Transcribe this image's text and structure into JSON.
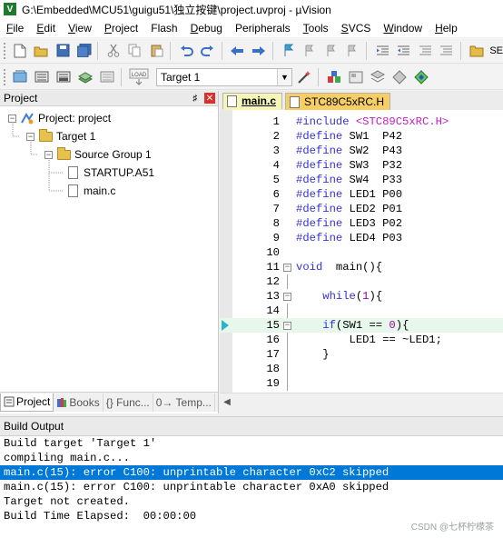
{
  "window": {
    "title": "G:\\Embedded\\MCU51\\guigu51\\独立按键\\project.uvproj - µVision"
  },
  "menu": [
    {
      "label": "File",
      "underline": "F",
      "rest": "ile"
    },
    {
      "label": "Edit",
      "underline": "E",
      "rest": "dit"
    },
    {
      "label": "View",
      "underline": "V",
      "rest": "iew"
    },
    {
      "label": "Project",
      "underline": "P",
      "rest": "roject"
    },
    {
      "label": "Flash",
      "underline": "",
      "rest": "Flash"
    },
    {
      "label": "Debug",
      "underline": "D",
      "rest": "ebug"
    },
    {
      "label": "Peripherals",
      "underline": "",
      "rest": "Peripherals"
    },
    {
      "label": "Tools",
      "underline": "T",
      "rest": "ools"
    },
    {
      "label": "SVCS",
      "underline": "S",
      "rest": "VCS"
    },
    {
      "label": "Window",
      "underline": "W",
      "rest": "indow"
    },
    {
      "label": "Help",
      "underline": "H",
      "rest": "elp"
    }
  ],
  "toolbar2": {
    "target": "Target 1",
    "load_label": "LOAD"
  },
  "toolbar1": {
    "overflow_label": "SE"
  },
  "project": {
    "title": "Project",
    "root": "Project: project",
    "target": "Target 1",
    "group": "Source Group 1",
    "files": [
      "STARTUP.A51",
      "main.c"
    ],
    "tabs": [
      "Project",
      "Books",
      "{} Func...",
      "0→ Temp..."
    ]
  },
  "editor": {
    "tabs": [
      "main.c",
      "STC89C5xRC.H"
    ],
    "active_line": 15,
    "lines": [
      {
        "n": "1",
        "text": "#include <STC89C5xRC.H>"
      },
      {
        "n": "2",
        "text": "#define SW1  P42"
      },
      {
        "n": "3",
        "text": "#define SW2  P43"
      },
      {
        "n": "4",
        "text": "#define SW3  P32"
      },
      {
        "n": "5",
        "text": "#define SW4  P33"
      },
      {
        "n": "6",
        "text": "#define LED1 P00"
      },
      {
        "n": "7",
        "text": "#define LED2 P01"
      },
      {
        "n": "8",
        "text": "#define LED3 P02"
      },
      {
        "n": "9",
        "text": "#define LED4 P03"
      },
      {
        "n": "10",
        "text": ""
      },
      {
        "n": "11",
        "text": "void  main(){"
      },
      {
        "n": "12",
        "text": ""
      },
      {
        "n": "13",
        "text": "    while(1){"
      },
      {
        "n": "14",
        "text": ""
      },
      {
        "n": "15",
        "text": "    if(SW1 == 0){"
      },
      {
        "n": "16",
        "text": "        LED1 == ~LED1;"
      },
      {
        "n": "17",
        "text": "    }"
      },
      {
        "n": "18",
        "text": ""
      },
      {
        "n": "19",
        "text": ""
      }
    ]
  },
  "build": {
    "title": "Build Output",
    "lines": [
      "Build target 'Target 1'",
      "compiling main.c...",
      "main.c(15): error C100: unprintable character 0xC2 skipped",
      "main.c(15): error C100: unprintable character 0xA0 skipped",
      "Target not created.",
      "Build Time Elapsed:  00:00:00"
    ],
    "selected_index": 2
  },
  "watermark": "CSDN @七杯柠檬茶",
  "colors": {
    "keyword": "#3333cc",
    "header_string": "#c020c0",
    "number": "#a000a0",
    "active_line_bg": "#e7f7ec",
    "selection_bg": "#0078d7",
    "tab_active_bg": "#f4f5b8",
    "tab_inactive_bg": "#f6ce63"
  }
}
